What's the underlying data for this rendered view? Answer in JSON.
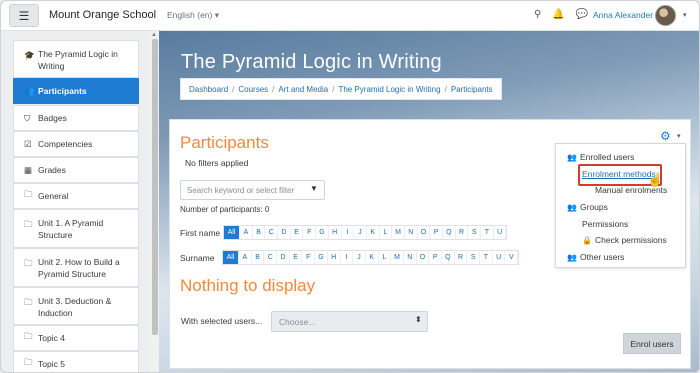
{
  "navbar": {
    "menu_icon": "hamburger-icon",
    "site_name": "Mount Orange School",
    "language": "English (en)",
    "user_name": "Anna Alexander"
  },
  "sidebar": {
    "items": [
      {
        "label": "The Pyramid Logic in Writing",
        "icon": "graduation-cap-icon"
      },
      {
        "label": "Participants",
        "icon": "users-icon"
      },
      {
        "label": "Badges",
        "icon": "shield-icon"
      },
      {
        "label": "Competencies",
        "icon": "check-square-icon"
      },
      {
        "label": "Grades",
        "icon": "table-icon"
      },
      {
        "label": "General",
        "icon": "folder-icon"
      },
      {
        "label": "Unit 1. A Pyramid Structure",
        "icon": "folder-icon"
      },
      {
        "label": "Unit 2. How to Build a Pyramid Structure",
        "icon": "folder-icon"
      },
      {
        "label": "Unit 3. Deduction & Induction",
        "icon": "folder-icon"
      },
      {
        "label": "Topic 4",
        "icon": "folder-icon"
      },
      {
        "label": "Topic 5",
        "icon": "folder-icon"
      }
    ]
  },
  "header": {
    "title": "The Pyramid Logic in Writing",
    "breadcrumb": [
      "Dashboard",
      "Courses",
      "Art and Media",
      "The Pyramid Logic in Writing",
      "Participants"
    ]
  },
  "participants": {
    "title": "Participants",
    "filters_text": "No filters applied",
    "search_placeholder": "Search keyword or select filter",
    "count_text": "Number of participants: 0",
    "firstname_label": "First name",
    "surname_label": "Surname",
    "all_label": "All",
    "firstname_letters": [
      "A",
      "B",
      "C",
      "D",
      "E",
      "F",
      "G",
      "H",
      "I",
      "J",
      "K",
      "L",
      "M",
      "N",
      "O",
      "P",
      "Q",
      "R",
      "S",
      "T",
      "U"
    ],
    "surname_letters": [
      "A",
      "B",
      "C",
      "D",
      "E",
      "F",
      "G",
      "H",
      "I",
      "J",
      "K",
      "L",
      "M",
      "N",
      "O",
      "P",
      "Q",
      "R",
      "S",
      "T",
      "U",
      "V"
    ],
    "nothing_text": "Nothing to display",
    "with_selected_label": "With selected users...",
    "choose_value": "Choose...",
    "enrol_button": "Enrol users"
  },
  "actions_menu": {
    "items": {
      "enrolled_users": "Enrolled users",
      "enrolment_methods": "Enrolment methods",
      "manual_enrolments": "Manual enrolments",
      "groups": "Groups",
      "permissions": "Permissions",
      "check_permissions": "Check permissions",
      "other_users": "Other users"
    }
  },
  "colors": {
    "accent": "#1f7ad1",
    "heading_orange": "#f6883b",
    "highlight_red": "#d43a2f"
  }
}
